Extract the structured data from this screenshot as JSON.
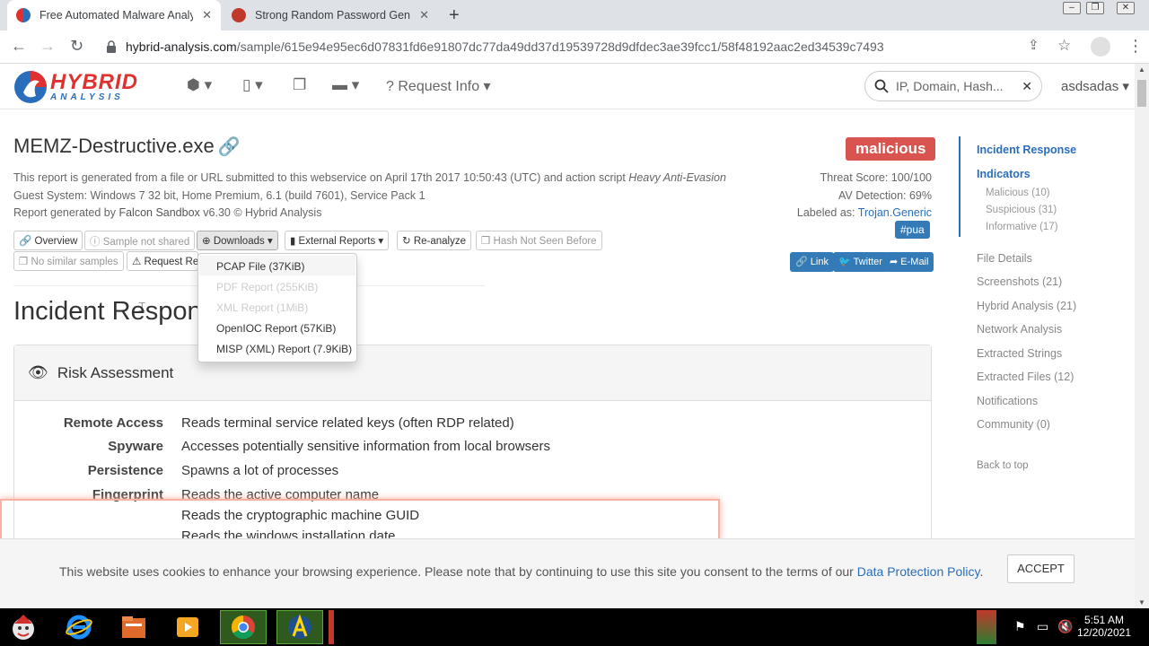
{
  "browser": {
    "tabs": [
      {
        "title": "Free Automated Malware Analysis",
        "active": true
      },
      {
        "title": "Strong Random Password Genera",
        "active": false
      }
    ],
    "url_host": "hybrid-analysis.com",
    "url_path": "/sample/615e94e95ec6d07831fd6e91807dc77da49dd37d19539728d9dfdec3ae39fcc1/58f48192aac2ed34539c7493"
  },
  "header": {
    "logo_line1": "HYBRID",
    "logo_line2": "ANALYSIS",
    "request_info": "Request Info",
    "search_placeholder": "IP, Domain, Hash...",
    "user": "asdsadas"
  },
  "report": {
    "title": "MEMZ-Destructive.exe",
    "meta_line1_a": "This report is generated from a file or URL submitted to this webservice on April 17th 2017 10:50:43 (UTC) and action script ",
    "meta_line1_b": "Heavy Anti-Evasion",
    "meta_line2": "Guest System: Windows 7 32 bit, Home Premium, 6.1 (build 7601), Service Pack 1",
    "meta_line3_a": "Report generated by ",
    "meta_line3_b": "Falcon Sandbox",
    "meta_line3_c": " v6.30 © Hybrid Analysis",
    "verdict": "malicious",
    "threat_score": "Threat Score: 100/100",
    "av_detection": "AV Detection: 69%",
    "labeled_as_label": "Labeled as: ",
    "labeled_as_value": "Trojan.Generic",
    "tag": "#pua",
    "share": {
      "link": "Link",
      "twitter": "Twitter",
      "email": "E-Mail"
    }
  },
  "actions": {
    "overview": "Overview",
    "sample_not_shared": "Sample not shared",
    "downloads": "Downloads",
    "external_reports": "External Reports",
    "reanalyze": "Re-analyze",
    "hash_not_seen": "Hash Not Seen Before",
    "no_similar": "No similar samples",
    "request_report": "Request Re"
  },
  "downloads_menu": [
    {
      "label": "PCAP File (37KiB)",
      "disabled": false
    },
    {
      "label": "PDF Report (255KiB)",
      "disabled": true
    },
    {
      "label": "XML Report (1MiB)",
      "disabled": true
    },
    {
      "label": "OpenIOC Report (57KiB)",
      "disabled": false
    },
    {
      "label": "MISP (XML) Report (7.9KiB)",
      "disabled": false
    }
  ],
  "section": {
    "heading": "Incident Respon",
    "panel_title": "Risk Assessment",
    "risks": [
      {
        "category": "Remote Access",
        "description": "Reads terminal service related keys (often RDP related)"
      },
      {
        "category": "Spyware",
        "description": "Accesses potentially sensitive information from local browsers"
      },
      {
        "category": "Persistence",
        "description": "Spawns a lot of processes"
      },
      {
        "category": "Fingerprint",
        "description": "Reads the active computer name"
      },
      {
        "category": "",
        "description": "Reads the cryptographic machine GUID"
      },
      {
        "category": "",
        "description": "Reads the windows installation date"
      }
    ]
  },
  "sidenav": {
    "incident_response": "Incident Response",
    "indicators": "Indicators",
    "malicious": "Malicious (10)",
    "suspicious": "Suspicious (31)",
    "informative": "Informative (17)",
    "file_details": "File Details",
    "screenshots": "Screenshots (21)",
    "hybrid_analysis": "Hybrid Analysis (21)",
    "network_analysis": "Network Analysis",
    "extracted_strings": "Extracted Strings",
    "extracted_files": "Extracted Files (12)",
    "notifications": "Notifications",
    "community": "Community (0)",
    "back_to_top": "Back to top"
  },
  "cookie": {
    "text": "This website uses cookies to enhance your browsing experience. Please note that by continuing to use this site you consent to the terms of our ",
    "link": "Data Protection Policy",
    "end": ".",
    "accept": "ACCEPT"
  },
  "taskbar": {
    "time": "5:51 AM",
    "date": "12/20/2021"
  },
  "colors": {
    "brand_red": "#e03131",
    "brand_blue": "#2a6ebb",
    "verdict_red": "#d9534f",
    "button_blue": "#337ab7"
  }
}
